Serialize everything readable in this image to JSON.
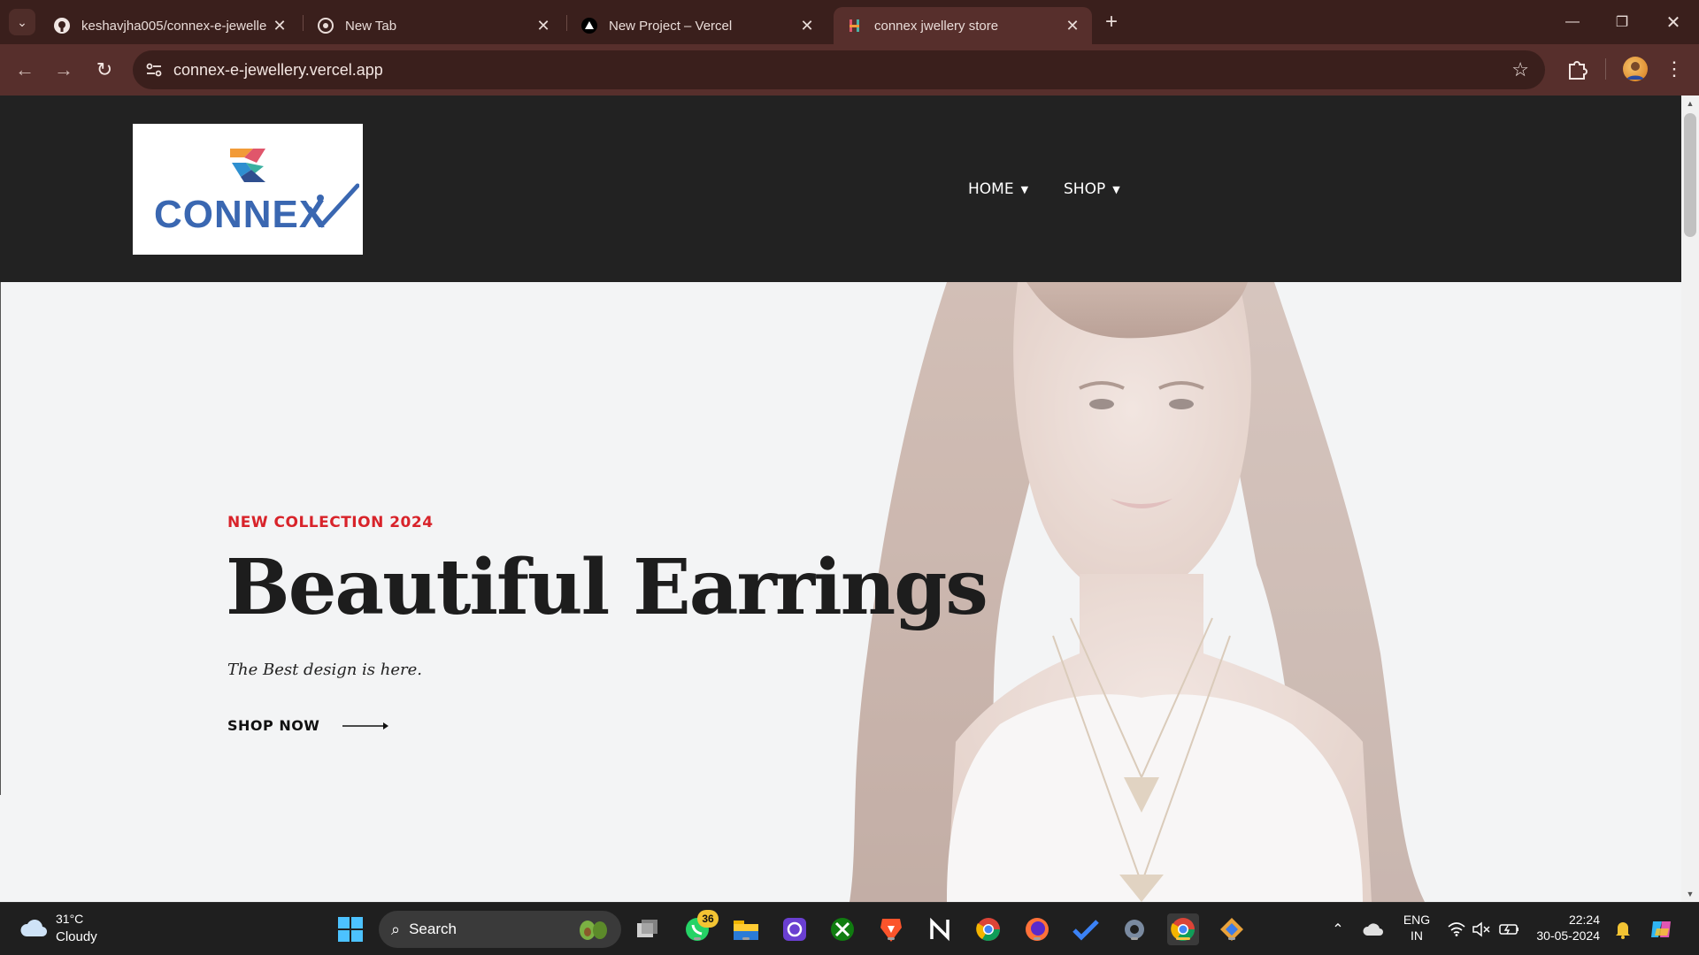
{
  "browser": {
    "tabs": [
      {
        "title": "keshavjha005/connex-e-jewelle",
        "favicon": "github-icon",
        "active": false
      },
      {
        "title": "New Tab",
        "favicon": "chrome-icon",
        "active": false
      },
      {
        "title": "New Project – Vercel",
        "favicon": "vercel-icon",
        "active": false
      },
      {
        "title": "connex jwellery store",
        "favicon": "site-icon",
        "active": true
      }
    ],
    "url": "connex-e-jewellery.vercel.app",
    "theme_color": "#572f2c"
  },
  "site": {
    "logo_text": "CONNEX",
    "nav": [
      {
        "label": "HOME"
      },
      {
        "label": "SHOP"
      }
    ],
    "hero": {
      "eyebrow": "NEW COLLECTION 2024",
      "title": "Beautiful Earrings",
      "tagline": "The Best design is here.",
      "cta": "SHOP NOW",
      "slides": 2,
      "active_slide": 2,
      "accent": "#d8232a"
    }
  },
  "taskbar": {
    "weather": {
      "temp": "31°C",
      "desc": "Cloudy"
    },
    "search_placeholder": "Search",
    "whatsapp_badge": "36",
    "lang_line1": "ENG",
    "lang_line2": "IN",
    "time": "22:24",
    "date": "30-05-2024"
  }
}
